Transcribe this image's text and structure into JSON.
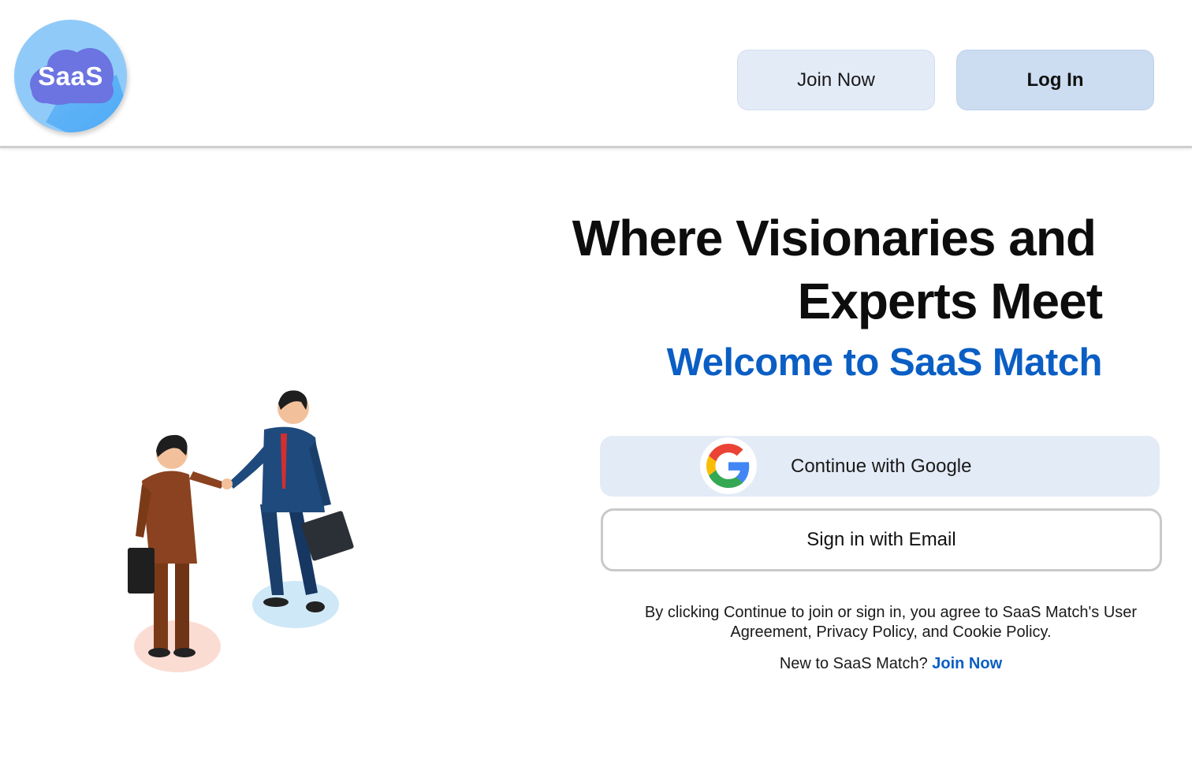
{
  "header": {
    "logo_text": "SaaS",
    "join_label": "Join Now",
    "login_label": "Log In"
  },
  "hero": {
    "heading_line1": "Where Visionaries and",
    "heading_line2": "Experts Meet",
    "welcome": "Welcome to SaaS Match"
  },
  "auth": {
    "google_label": "Continue with Google",
    "email_label": "Sign in with Email",
    "terms_line1": "By clicking Continue to join or sign in, you agree to SaaS Match's User",
    "terms_line2": "Agreement, Privacy Policy, and Cookie Policy.",
    "new_prompt": "New to SaaS Match?",
    "new_link": "Join Now"
  },
  "icons": {
    "logo": "saas-cloud-logo",
    "google": "google-g-icon",
    "illustration": "businessmen-handshake-illustration"
  },
  "colors": {
    "accent_blue": "#0a5ec4",
    "join_button_bg": "#e3ebf7",
    "login_button_bg": "#ccdcf1",
    "logo_circle": "#90caf9",
    "logo_cloud": "#6b74e0"
  }
}
